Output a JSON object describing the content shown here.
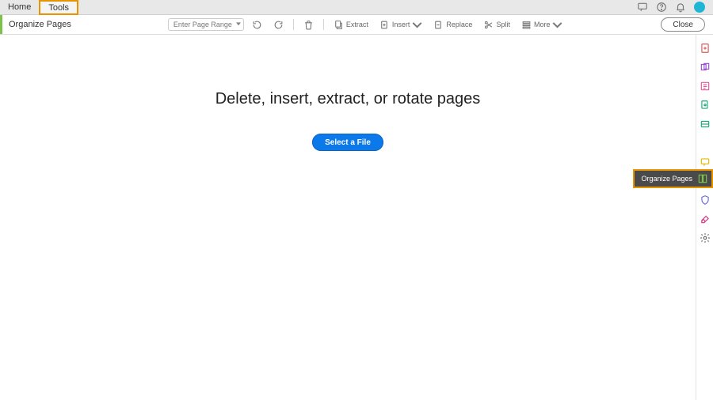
{
  "header": {
    "tabs": {
      "home": "Home",
      "tools": "Tools"
    },
    "icons": {
      "feedback": "chat-icon",
      "help": "help-icon",
      "notifications": "bell-icon",
      "account": "avatar"
    }
  },
  "toolbar": {
    "panel_title": "Organize Pages",
    "page_range_placeholder": "Enter Page Range",
    "buttons": {
      "rotate_ccw": "",
      "rotate_cw": "",
      "delete": "",
      "extract": "Extract",
      "insert": "Insert",
      "replace": "Replace",
      "split": "Split",
      "more": "More"
    },
    "close": "Close"
  },
  "main": {
    "headline": "Delete, insert, extract, or rotate pages",
    "select_file": "Select a File"
  },
  "right_rail": {
    "items": [
      {
        "name": "create-pdf-icon",
        "color": "#e05a5a"
      },
      {
        "name": "combine-icon",
        "color": "#9a4bd1"
      },
      {
        "name": "edit-pdf-icon",
        "color": "#e05a9e"
      },
      {
        "name": "export-pdf-icon",
        "color": "#1fa97a"
      },
      {
        "name": "organize-slot",
        "color": "#1fa97a"
      },
      {
        "name": "spacer",
        "color": "transparent"
      },
      {
        "name": "comment-icon",
        "color": "#e6b800"
      },
      {
        "name": "fill-sign-icon",
        "color": "#e6b800"
      },
      {
        "name": "protect-icon",
        "color": "#6a6ae0"
      },
      {
        "name": "sign-tool-icon",
        "color": "#d63384"
      },
      {
        "name": "more-tools-icon",
        "color": "#666666"
      }
    ]
  },
  "floating": {
    "organize_label": "Organize Pages"
  },
  "colors": {
    "highlight": "#e69500",
    "accent_green": "#7cc24a",
    "primary_button": "#0b79ea"
  }
}
